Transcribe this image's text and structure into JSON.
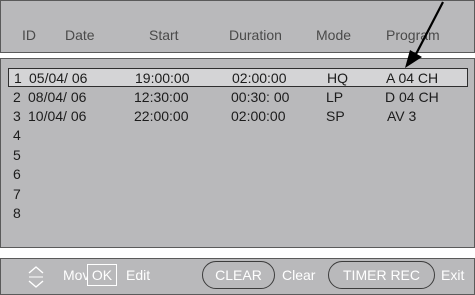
{
  "header": {
    "columns": [
      "ID",
      "Date",
      "Start",
      "Duration",
      "Mode",
      "Program"
    ]
  },
  "list": {
    "selected_index": 0,
    "rows": [
      {
        "id": "1",
        "date": "05/04/ 06",
        "start": "19:00:00",
        "duration": "02:00:00",
        "mode": "HQ",
        "program": "A 04 CH"
      },
      {
        "id": "2",
        "date": "08/04/ 06",
        "start": "12:30:00",
        "duration": "00:30: 00",
        "mode": "LP",
        "program": "D 04 CH"
      },
      {
        "id": "3",
        "date": "10/04/ 06",
        "start": "22:00:00",
        "duration": "02:00:00",
        "mode": "SP",
        "program": "AV 3"
      },
      {
        "id": "4",
        "date": "",
        "start": "",
        "duration": "",
        "mode": "",
        "program": ""
      },
      {
        "id": "5",
        "date": "",
        "start": "",
        "duration": "",
        "mode": "",
        "program": ""
      },
      {
        "id": "6",
        "date": "",
        "start": "",
        "duration": "",
        "mode": "",
        "program": ""
      },
      {
        "id": "7",
        "date": "",
        "start": "",
        "duration": "",
        "mode": "",
        "program": ""
      },
      {
        "id": "8",
        "date": "",
        "start": "",
        "duration": "",
        "mode": "",
        "program": ""
      }
    ]
  },
  "footer": {
    "move_label": "Move",
    "ok_key": "OK",
    "edit_label": "Edit",
    "clear_key": "CLEAR",
    "clear_label": "Clear",
    "timer_rec_key": "TIMER REC",
    "exit_label": "Exit"
  },
  "icons": {
    "up_down": "up-down-arrows-icon",
    "callout": "callout-arrow-icon"
  },
  "colors": {
    "panel": "#b9b9bb",
    "highlight": "#d4d4d6",
    "text_dark": "#1c1c1c",
    "text_light": "#ffffff"
  }
}
